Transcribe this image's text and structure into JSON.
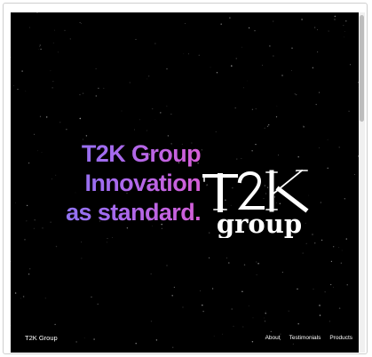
{
  "hero": {
    "headline_lines": [
      "T2K Group",
      "Innovation",
      "as standard."
    ],
    "gradient": [
      "#7f7bf2",
      "#a06cf0",
      "#d55ed8"
    ]
  },
  "logo": {
    "text_main": "T2K",
    "text_sub": "group",
    "color": "#ffffff"
  },
  "footer": {
    "brand": "T2K Group",
    "nav": [
      "About",
      "Testimonials",
      "Products"
    ]
  },
  "colors": {
    "background": "#000000",
    "text": "#ffffff"
  }
}
